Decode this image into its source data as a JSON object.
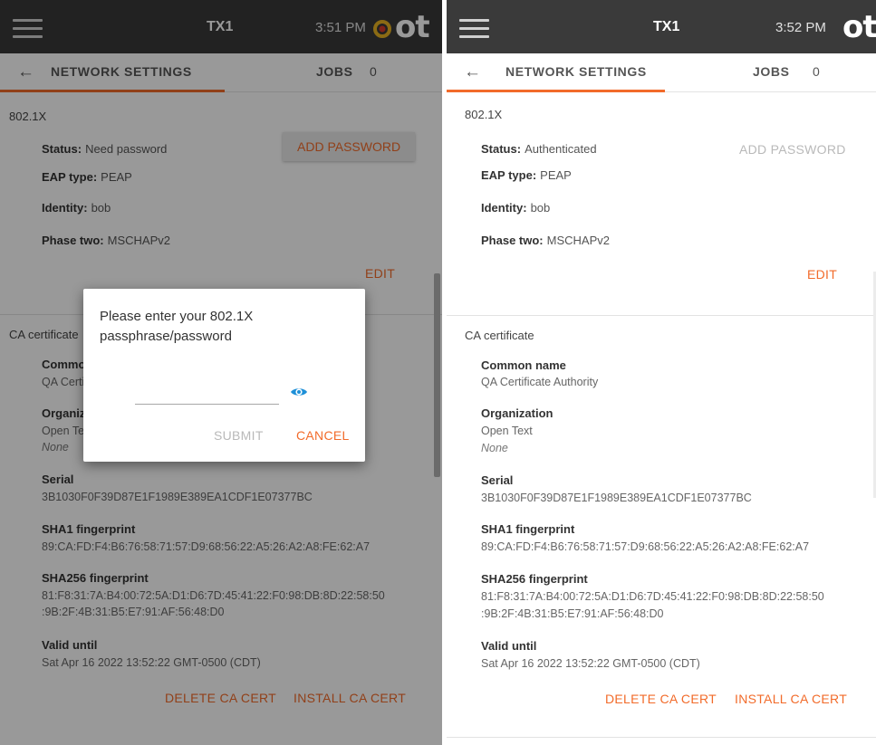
{
  "colors": {
    "accent": "#f26b2a",
    "topbar": "#3a3a3a",
    "disabled": "#b9b9b9"
  },
  "left": {
    "topbar": {
      "menu_icon": "hamburger-menu-icon",
      "title": "TX1",
      "time": "3:51 PM",
      "logo_mark_icon": "ot-gear-logo-icon",
      "logo": "ot"
    },
    "nav": {
      "back_icon": "back-arrow-icon",
      "tab": "NETWORK SETTINGS",
      "jobs_label": "JOBS",
      "jobs_count": "0"
    },
    "dot1x": {
      "title": "802.1X",
      "status_label": "Status:",
      "status_value": "Need password",
      "add_password": "ADD PASSWORD",
      "eap_label": "EAP type:",
      "eap_value": "PEAP",
      "identity_label": "Identity:",
      "identity_value": "bob",
      "phase_label": "Phase two:",
      "phase_value": "MSCHAPv2",
      "edit": "EDIT"
    },
    "ca": {
      "title": "CA certificate",
      "common_name_label": "Common name",
      "common_name_value": "QA Certificate Authority",
      "org_label": "Organization",
      "org_value": "Open Text",
      "org_unit": "None",
      "serial_label": "Serial",
      "serial_value": "3B1030F0F39D87E1F1989E389EA1CDF1E07377BC",
      "sha1_label": "SHA1 fingerprint",
      "sha1_value": "89:CA:FD:F4:B6:76:58:71:57:D9:68:56:22:A5:26:A2:A8:FE:62:A7",
      "sha256_label": "SHA256 fingerprint",
      "sha256_line1": "81:F8:31:7A:B4:00:72:5A:D1:D6:7D:45:41:22:F0:98:DB:8D:22:58:50",
      "sha256_line2": ":9B:2F:4B:31:B5:E7:91:AF:56:48:D0",
      "valid_label": "Valid until",
      "valid_value": "Sat Apr 16 2022 13:52:22 GMT-0500 (CDT)",
      "delete": "DELETE CA CERT",
      "install": "INSTALL CA CERT"
    },
    "dialog": {
      "message": "Please enter your 802.1X passphrase/password",
      "input_value": "",
      "eye_icon": "show-password-eye-icon",
      "submit": "SUBMIT",
      "cancel": "CANCEL"
    }
  },
  "right": {
    "topbar": {
      "menu_icon": "hamburger-menu-icon",
      "title": "TX1",
      "time": "3:52 PM",
      "logo": "ot"
    },
    "nav": {
      "back_icon": "back-arrow-icon",
      "tab": "NETWORK SETTINGS",
      "jobs_label": "JOBS",
      "jobs_count": "0"
    },
    "dot1x": {
      "title": "802.1X",
      "status_label": "Status:",
      "status_value": "Authenticated",
      "add_password": "ADD PASSWORD",
      "eap_label": "EAP type:",
      "eap_value": "PEAP",
      "identity_label": "Identity:",
      "identity_value": "bob",
      "phase_label": "Phase two:",
      "phase_value": "MSCHAPv2",
      "edit": "EDIT"
    },
    "ca": {
      "title": "CA certificate",
      "common_name_label": "Common name",
      "common_name_value": "QA Certificate Authority",
      "org_label": "Organization",
      "org_value": "Open Text",
      "org_unit": "None",
      "serial_label": "Serial",
      "serial_value": "3B1030F0F39D87E1F1989E389EA1CDF1E07377BC",
      "sha1_label": "SHA1 fingerprint",
      "sha1_value": "89:CA:FD:F4:B6:76:58:71:57:D9:68:56:22:A5:26:A2:A8:FE:62:A7",
      "sha256_label": "SHA256 fingerprint",
      "sha256_line1": "81:F8:31:7A:B4:00:72:5A:D1:D6:7D:45:41:22:F0:98:DB:8D:22:58:50",
      "sha256_line2": ":9B:2F:4B:31:B5:E7:91:AF:56:48:D0",
      "valid_label": "Valid until",
      "valid_value": "Sat Apr 16 2022 13:52:22 GMT-0500 (CDT)",
      "delete": "DELETE CA CERT",
      "install": "INSTALL CA CERT"
    }
  }
}
